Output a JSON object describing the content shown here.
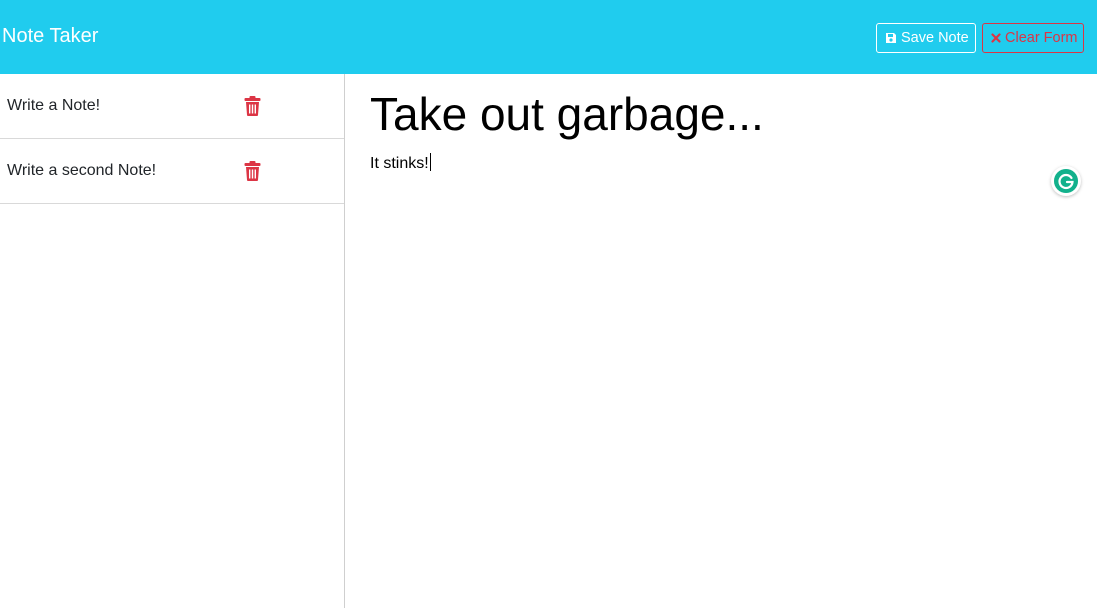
{
  "app": {
    "brand": "Note Taker"
  },
  "toolbar": {
    "save_label": "Save Note",
    "save_icon": "floppy-disk-icon",
    "clear_label": "Clear Form",
    "clear_icon": "x-icon"
  },
  "sidebar": {
    "notes": [
      {
        "title": "Write a Note!",
        "icon": "trash-icon"
      },
      {
        "title": "Write a second Note!",
        "icon": "trash-icon"
      }
    ]
  },
  "editor": {
    "title_value": "Take out garbage...",
    "body_value": "It stinks!"
  },
  "colors": {
    "navbar": "#20ccee",
    "danger": "#dc3545",
    "grammarly": "#15c39a"
  }
}
